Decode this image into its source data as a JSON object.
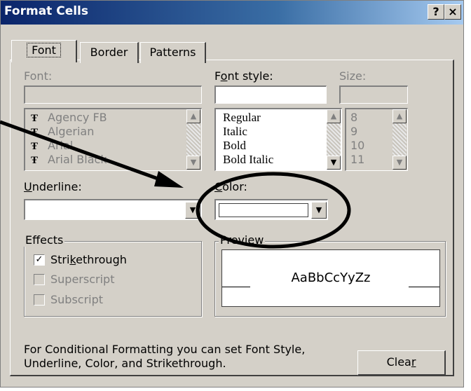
{
  "window": {
    "title": "Format Cells",
    "help_button": "?",
    "close_button": "×"
  },
  "tabs": [
    {
      "label": "Font",
      "active": true
    },
    {
      "label": "Border",
      "active": false
    },
    {
      "label": "Patterns",
      "active": false
    }
  ],
  "font": {
    "label": "Font:",
    "value": "",
    "items": [
      "Agency FB",
      "Algerian",
      "Arial",
      "Arial Black"
    ],
    "item_icon": "truetype-font-icon"
  },
  "font_style": {
    "label_pre": "F",
    "label_key": "o",
    "label_post": "nt style:",
    "value": "",
    "items": [
      "Regular",
      "Italic",
      "Bold",
      "Bold Italic"
    ]
  },
  "size": {
    "label": "Size:",
    "value": "",
    "items": [
      "8",
      "9",
      "10",
      "11"
    ]
  },
  "underline": {
    "label_key": "U",
    "label_post": "nderline:",
    "value": ""
  },
  "color": {
    "label_key": "C",
    "label_post": "olor:",
    "value": "",
    "swatch_color": "#ffffff"
  },
  "effects": {
    "legend": "Effects",
    "strikethrough": {
      "pre": "Stri",
      "key": "k",
      "post": "ethrough",
      "checked": true,
      "enabled": true
    },
    "superscript": {
      "label": "Superscript",
      "checked": false,
      "enabled": false
    },
    "subscript": {
      "label": "Subscript",
      "checked": false,
      "enabled": false
    }
  },
  "preview": {
    "legend": "Preview",
    "sample": "AaBbCcYyZz"
  },
  "info_text_line1": "For Conditional Formatting you can set Font Style,",
  "info_text_line2": "Underline, Color, and Strikethrough.",
  "clear_button": {
    "pre": "Clea",
    "key": "r"
  },
  "annotation": {
    "shape": "arrow-and-ellipse",
    "target": "color dropdown",
    "color": "#000000"
  },
  "colors": {
    "titlebar": "#0a246a",
    "face": "#d4d0c8",
    "disabled_text": "#808080"
  }
}
